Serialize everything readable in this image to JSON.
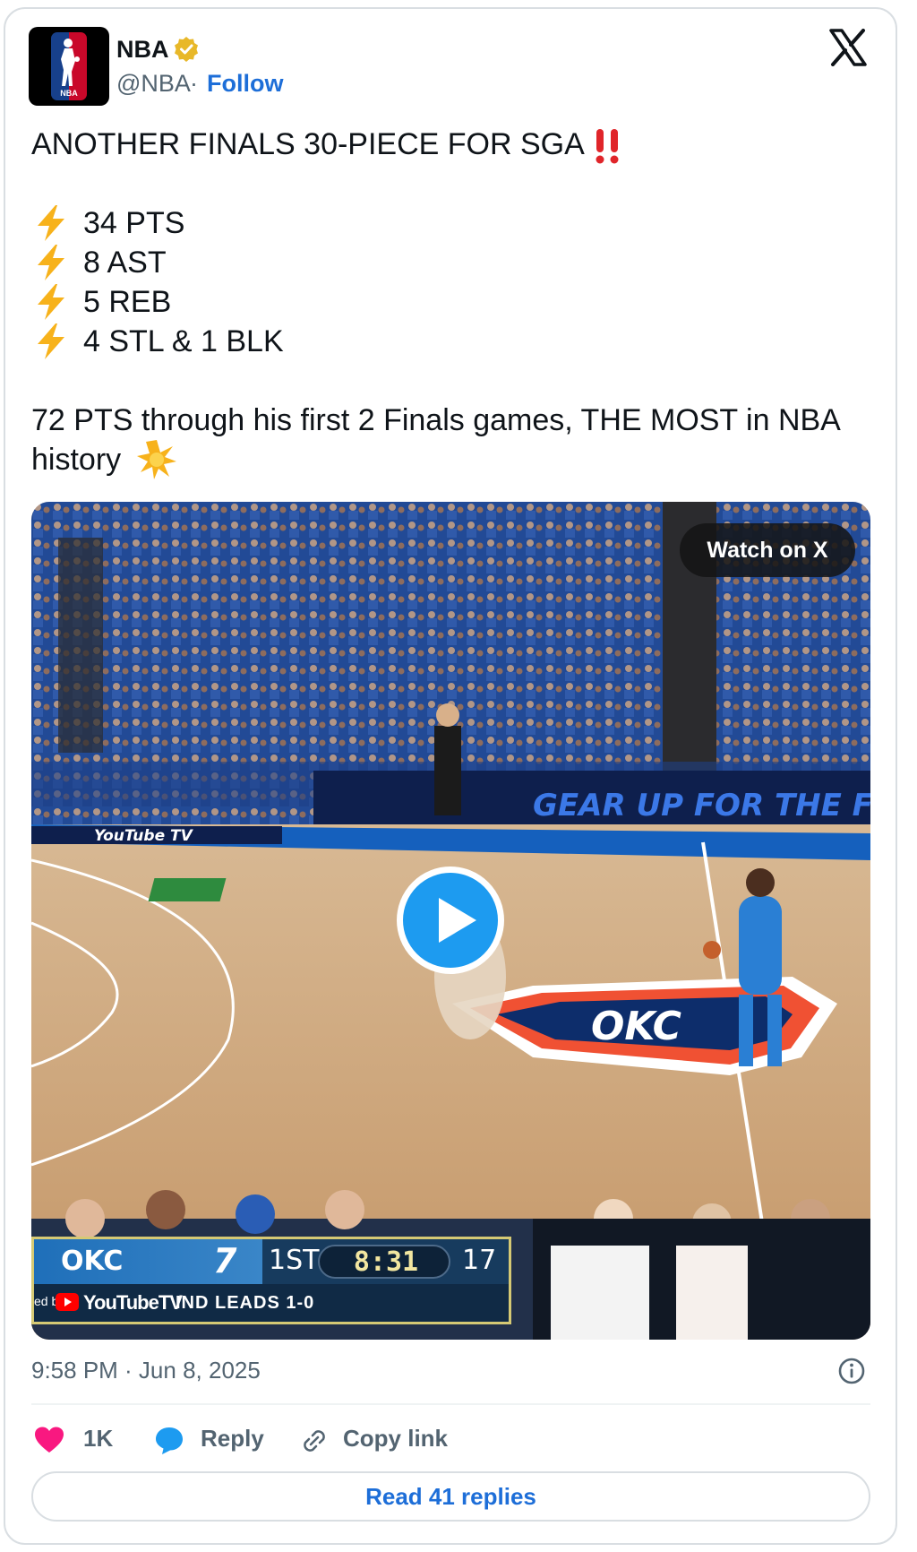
{
  "author": {
    "name": "NBA",
    "handle": "@NBA",
    "separator": "·",
    "follow_label": "Follow",
    "verified": true,
    "avatar_icon": "nba-logo-icon",
    "avatar_text": "NBA"
  },
  "platform_icon": "x-logo-icon",
  "tweet": {
    "headline": "ANOTHER FINALS 30-PIECE FOR SGA",
    "headline_emoji": "double-exclamation-icon",
    "stats": [
      "34 PTS",
      "8 AST",
      "5 REB",
      "4 STL & 1 BLK"
    ],
    "stat_emoji": "lightning-icon",
    "summary_line1": "72 PTS through his first 2 Finals games, THE MOST in NBA",
    "summary_line2": "history",
    "summary_emoji": "star-icon"
  },
  "video": {
    "watch_label": "Watch on X",
    "play_icon": "play-icon",
    "scoreboard": {
      "team": "OKC",
      "score": "7",
      "quarter": "1ST",
      "clock": "8:31",
      "shot_clock": "17",
      "presented_by": "ed by",
      "sponsor": "YouTubeTV",
      "series": "IND LEADS 1-0"
    },
    "court_banner": "GEAR UP FOR THE FI",
    "court_brand": "YouTube TV",
    "court_logo": "OKC"
  },
  "timestamp": "9:58 PM · Jun 8, 2025",
  "actions": {
    "like_count": "1K",
    "reply_label": "Reply",
    "copy_label": "Copy link"
  },
  "read_replies_label": "Read 41 replies",
  "colors": {
    "accent": "#1d6ed8",
    "like": "#f91880",
    "play": "#1d9bf0",
    "verified": "#e8b829"
  }
}
